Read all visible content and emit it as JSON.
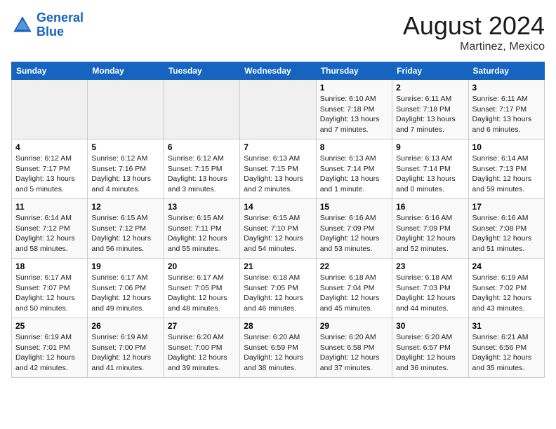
{
  "header": {
    "logo_line1": "General",
    "logo_line2": "Blue",
    "month_year": "August 2024",
    "location": "Martinez, Mexico"
  },
  "days_of_week": [
    "Sunday",
    "Monday",
    "Tuesday",
    "Wednesday",
    "Thursday",
    "Friday",
    "Saturday"
  ],
  "weeks": [
    [
      {
        "day": "",
        "info": ""
      },
      {
        "day": "",
        "info": ""
      },
      {
        "day": "",
        "info": ""
      },
      {
        "day": "",
        "info": ""
      },
      {
        "day": "1",
        "info": "Sunrise: 6:10 AM\nSunset: 7:18 PM\nDaylight: 13 hours\nand 7 minutes."
      },
      {
        "day": "2",
        "info": "Sunrise: 6:11 AM\nSunset: 7:18 PM\nDaylight: 13 hours\nand 7 minutes."
      },
      {
        "day": "3",
        "info": "Sunrise: 6:11 AM\nSunset: 7:17 PM\nDaylight: 13 hours\nand 6 minutes."
      }
    ],
    [
      {
        "day": "4",
        "info": "Sunrise: 6:12 AM\nSunset: 7:17 PM\nDaylight: 13 hours\nand 5 minutes."
      },
      {
        "day": "5",
        "info": "Sunrise: 6:12 AM\nSunset: 7:16 PM\nDaylight: 13 hours\nand 4 minutes."
      },
      {
        "day": "6",
        "info": "Sunrise: 6:12 AM\nSunset: 7:15 PM\nDaylight: 13 hours\nand 3 minutes."
      },
      {
        "day": "7",
        "info": "Sunrise: 6:13 AM\nSunset: 7:15 PM\nDaylight: 13 hours\nand 2 minutes."
      },
      {
        "day": "8",
        "info": "Sunrise: 6:13 AM\nSunset: 7:14 PM\nDaylight: 13 hours\nand 1 minute."
      },
      {
        "day": "9",
        "info": "Sunrise: 6:13 AM\nSunset: 7:14 PM\nDaylight: 13 hours\nand 0 minutes."
      },
      {
        "day": "10",
        "info": "Sunrise: 6:14 AM\nSunset: 7:13 PM\nDaylight: 12 hours\nand 59 minutes."
      }
    ],
    [
      {
        "day": "11",
        "info": "Sunrise: 6:14 AM\nSunset: 7:12 PM\nDaylight: 12 hours\nand 58 minutes."
      },
      {
        "day": "12",
        "info": "Sunrise: 6:15 AM\nSunset: 7:12 PM\nDaylight: 12 hours\nand 56 minutes."
      },
      {
        "day": "13",
        "info": "Sunrise: 6:15 AM\nSunset: 7:11 PM\nDaylight: 12 hours\nand 55 minutes."
      },
      {
        "day": "14",
        "info": "Sunrise: 6:15 AM\nSunset: 7:10 PM\nDaylight: 12 hours\nand 54 minutes."
      },
      {
        "day": "15",
        "info": "Sunrise: 6:16 AM\nSunset: 7:09 PM\nDaylight: 12 hours\nand 53 minutes."
      },
      {
        "day": "16",
        "info": "Sunrise: 6:16 AM\nSunset: 7:09 PM\nDaylight: 12 hours\nand 52 minutes."
      },
      {
        "day": "17",
        "info": "Sunrise: 6:16 AM\nSunset: 7:08 PM\nDaylight: 12 hours\nand 51 minutes."
      }
    ],
    [
      {
        "day": "18",
        "info": "Sunrise: 6:17 AM\nSunset: 7:07 PM\nDaylight: 12 hours\nand 50 minutes."
      },
      {
        "day": "19",
        "info": "Sunrise: 6:17 AM\nSunset: 7:06 PM\nDaylight: 12 hours\nand 49 minutes."
      },
      {
        "day": "20",
        "info": "Sunrise: 6:17 AM\nSunset: 7:05 PM\nDaylight: 12 hours\nand 48 minutes."
      },
      {
        "day": "21",
        "info": "Sunrise: 6:18 AM\nSunset: 7:05 PM\nDaylight: 12 hours\nand 46 minutes."
      },
      {
        "day": "22",
        "info": "Sunrise: 6:18 AM\nSunset: 7:04 PM\nDaylight: 12 hours\nand 45 minutes."
      },
      {
        "day": "23",
        "info": "Sunrise: 6:18 AM\nSunset: 7:03 PM\nDaylight: 12 hours\nand 44 minutes."
      },
      {
        "day": "24",
        "info": "Sunrise: 6:19 AM\nSunset: 7:02 PM\nDaylight: 12 hours\nand 43 minutes."
      }
    ],
    [
      {
        "day": "25",
        "info": "Sunrise: 6:19 AM\nSunset: 7:01 PM\nDaylight: 12 hours\nand 42 minutes."
      },
      {
        "day": "26",
        "info": "Sunrise: 6:19 AM\nSunset: 7:00 PM\nDaylight: 12 hours\nand 41 minutes."
      },
      {
        "day": "27",
        "info": "Sunrise: 6:20 AM\nSunset: 7:00 PM\nDaylight: 12 hours\nand 39 minutes."
      },
      {
        "day": "28",
        "info": "Sunrise: 6:20 AM\nSunset: 6:59 PM\nDaylight: 12 hours\nand 38 minutes."
      },
      {
        "day": "29",
        "info": "Sunrise: 6:20 AM\nSunset: 6:58 PM\nDaylight: 12 hours\nand 37 minutes."
      },
      {
        "day": "30",
        "info": "Sunrise: 6:20 AM\nSunset: 6:57 PM\nDaylight: 12 hours\nand 36 minutes."
      },
      {
        "day": "31",
        "info": "Sunrise: 6:21 AM\nSunset: 6:56 PM\nDaylight: 12 hours\nand 35 minutes."
      }
    ]
  ]
}
